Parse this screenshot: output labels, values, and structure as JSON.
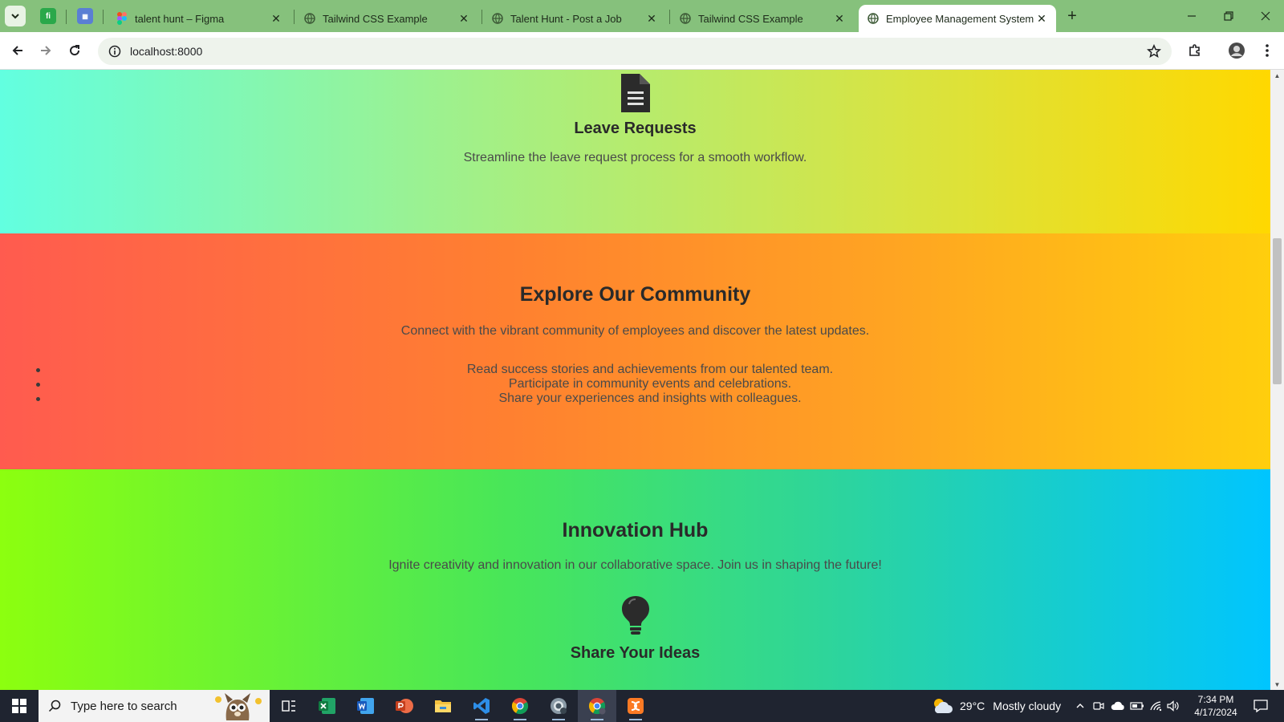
{
  "browser": {
    "tabs": [
      {
        "title": "talent hunt – Figma",
        "active": false
      },
      {
        "title": "Tailwind CSS Example",
        "active": false
      },
      {
        "title": "Talent Hunt - Post a Job",
        "active": false
      },
      {
        "title": "Tailwind CSS Example",
        "active": false
      },
      {
        "title": "Employee Management System",
        "active": true
      }
    ],
    "url": "localhost:8000"
  },
  "page": {
    "feature_leave": {
      "title": "Leave Requests",
      "description": "Streamline the leave request process for a smooth workflow."
    },
    "community": {
      "title": "Explore Our Community",
      "subtitle": "Connect with the vibrant community of employees and discover the latest updates.",
      "items": [
        "Read success stories and achievements from our talented team.",
        "Participate in community events and celebrations.",
        "Share your experiences and insights with colleagues."
      ]
    },
    "innovation": {
      "title": "Innovation Hub",
      "subtitle": "Ignite creativity and innovation in our collaborative space. Join us in shaping the future!",
      "feature_title": "Share Your Ideas"
    },
    "scroll_position_fraction": 0.27
  },
  "taskbar": {
    "search_placeholder": "Type here to search",
    "weather": {
      "temp": "29°C",
      "condition": "Mostly cloudy"
    },
    "time": "7:34 PM",
    "date": "4/17/2024",
    "apps": [
      "task-view-icon",
      "excel-icon",
      "word-icon",
      "powerpoint-icon",
      "file-explorer-icon",
      "vscode-icon",
      "chrome-icon",
      "chrome-profile-icon",
      "chrome-active-icon",
      "xampp-icon"
    ]
  },
  "colors": {
    "browser_frame": "#86c17c",
    "section1_gradient": [
      "#62ffe0",
      "#ffd800"
    ],
    "section2_gradient": [
      "#ff5b4f",
      "#ffce0d"
    ],
    "section3_gradient": [
      "#8cff0f",
      "#00c5ff"
    ],
    "taskbar": "#1f2430"
  }
}
